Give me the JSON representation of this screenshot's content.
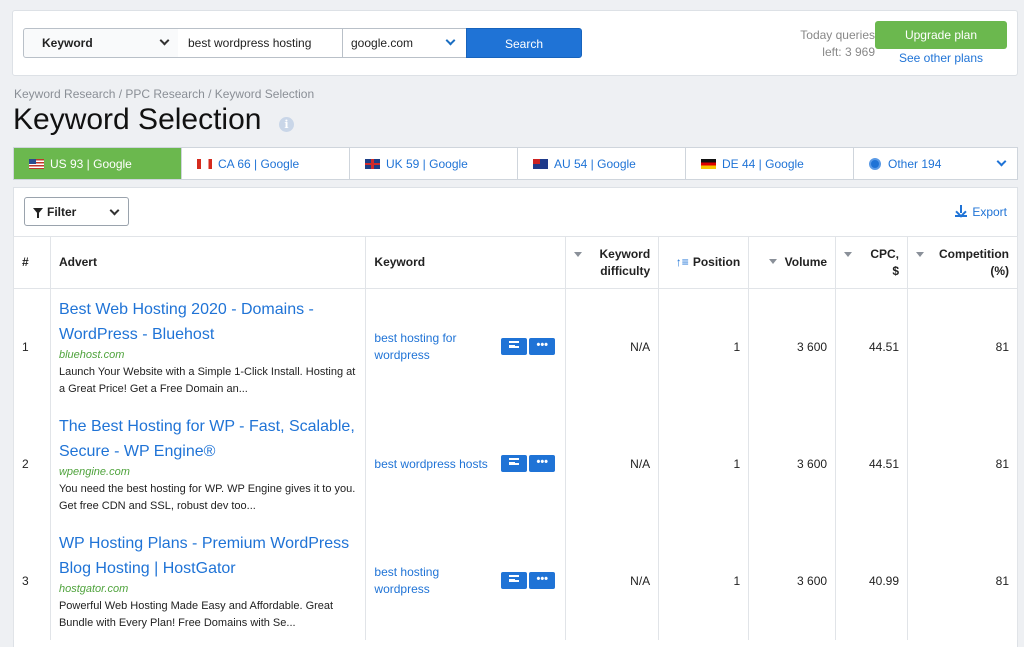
{
  "search": {
    "database_label": "Keyword",
    "query": "best wordpress hosting",
    "domain": "google.com",
    "button": "Search",
    "queries_line1": "Today queries",
    "queries_line2": "left: 3 969",
    "upgrade": "Upgrade plan",
    "other_plans": "See other plans"
  },
  "breadcrumb": "Keyword Research / PPC Research / Keyword Selection",
  "page_title": "Keyword Selection",
  "tabs": [
    {
      "flag": "us-flag-icon",
      "label": "US 93 | Google"
    },
    {
      "flag": "ca-flag-icon",
      "label": "CA 66 | Google"
    },
    {
      "flag": "uk-flag-icon",
      "label": "UK 59 | Google"
    },
    {
      "flag": "au-flag-icon",
      "label": "AU 54 | Google"
    },
    {
      "flag": "de-flag-icon",
      "label": "DE 44 | Google"
    },
    {
      "flag": "globe-icon",
      "label": "Other 194"
    }
  ],
  "toolbar": {
    "filter": "Filter",
    "export": "Export"
  },
  "table": {
    "headers": {
      "index": "#",
      "advert": "Advert",
      "keyword": "Keyword",
      "kd_line1": "Keyword",
      "kd_line2": "difficulty",
      "position": "Position",
      "volume": "Volume",
      "cpc_line1": "CPC,",
      "cpc_line2": "$",
      "comp_line1": "Competition",
      "comp_line2": "(%)"
    },
    "rows": [
      {
        "index": "1",
        "title": "Best Web Hosting 2020 - Domains - WordPress - Bluehost",
        "domain": "bluehost.com",
        "desc": "Launch Your Website with a Simple 1-Click Install. Hosting at a Great Price! Get a Free Domain an...",
        "keyword": "best hosting for wordpress",
        "kd": "N/A",
        "position": "1",
        "volume": "3 600",
        "cpc": "44.51",
        "competition": "81"
      },
      {
        "index": "2",
        "title": "The Best Hosting for WP - Fast, Scalable, Secure - WP Engine®",
        "domain": "wpengine.com",
        "desc": "You need the best hosting for WP. WP Engine gives it to you. Get free CDN and SSL, robust dev too...",
        "keyword": "best wordpress hosts",
        "kd": "N/A",
        "position": "1",
        "volume": "3 600",
        "cpc": "44.51",
        "competition": "81"
      },
      {
        "index": "3",
        "title": "WP Hosting Plans - Premium WordPress Blog Hosting | HostGator",
        "domain": "hostgator.com",
        "desc": "Powerful Web Hosting Made Easy and Affordable. Great Bundle with Every Plan! Free Domains with Se...",
        "keyword": "best hosting wordpress",
        "kd": "N/A",
        "position": "1",
        "volume": "3 600",
        "cpc": "40.99",
        "competition": "81"
      }
    ]
  },
  "colors": {
    "accent": "#1f73d6",
    "active_tab": "#6bb84e",
    "domain_green": "#4fa33c"
  }
}
